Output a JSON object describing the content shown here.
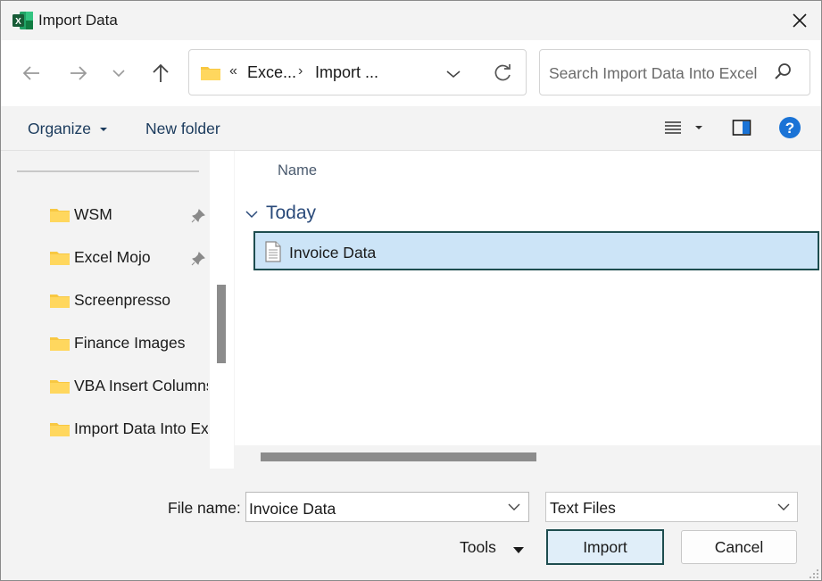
{
  "window": {
    "title": "Import Data",
    "app_icon": "excel-icon"
  },
  "navigation": {
    "back": "arrow-left-icon",
    "forward": "arrow-right-icon",
    "recent": "chevron-down-icon",
    "up": "arrow-up-icon"
  },
  "address_bar": {
    "overflow": "«",
    "crumbs": [
      "Exce...",
      "Import ..."
    ],
    "separator": "›"
  },
  "search": {
    "placeholder": "Search Import Data Into Excel"
  },
  "commands": {
    "organize": "Organize",
    "new_folder": "New folder"
  },
  "nav_pane": {
    "items": [
      {
        "label": "WSM",
        "pinned": true
      },
      {
        "label": "Excel Mojo",
        "pinned": true
      },
      {
        "label": "Screenpresso",
        "pinned": false
      },
      {
        "label": "Finance Images",
        "pinned": false
      },
      {
        "label": "VBA Insert Columns",
        "pinned": false
      },
      {
        "label": "Import Data Into Excel",
        "pinned": false
      }
    ]
  },
  "file_list": {
    "column_header": "Name",
    "group": "Today",
    "files": [
      {
        "name": "Invoice Data",
        "selected": true
      }
    ]
  },
  "bottom": {
    "file_name_label": "File name:",
    "file_name_value": "Invoice Data",
    "file_type": "Text Files",
    "tools": "Tools",
    "import": "Import",
    "cancel": "Cancel"
  },
  "colors": {
    "accent": "#1e4d4f",
    "selection": "#cce4f7",
    "folder": "#f8c842",
    "help": "#1a73d6",
    "excel_green": "#1f7a43"
  }
}
